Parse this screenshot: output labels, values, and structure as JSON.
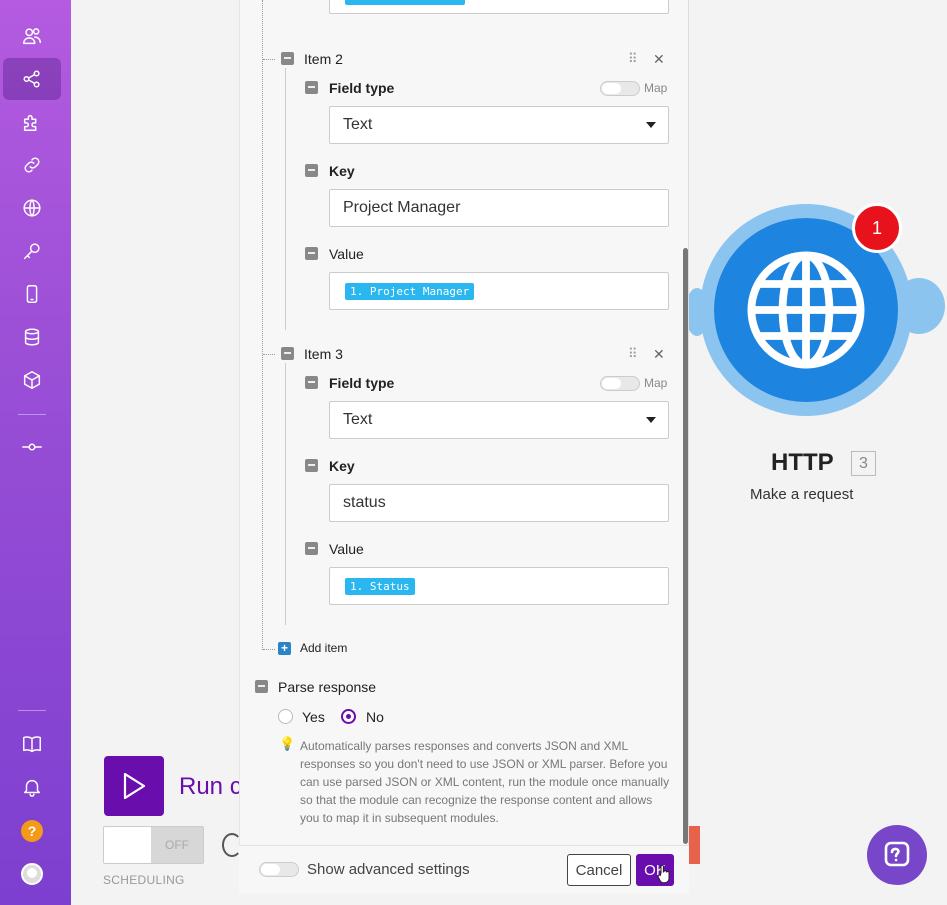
{
  "sidebar": {
    "items": [
      {
        "icon": "team-icon",
        "active": false
      },
      {
        "icon": "share-scenarios-icon",
        "active": true
      },
      {
        "icon": "puzzle-apps-icon",
        "active": false
      },
      {
        "icon": "link-connections-icon",
        "active": false
      },
      {
        "icon": "globe-webhooks-icon",
        "active": false
      },
      {
        "icon": "key-icon",
        "active": false
      },
      {
        "icon": "mobile-devices-icon",
        "active": false
      },
      {
        "icon": "database-datastores-icon",
        "active": false
      },
      {
        "icon": "cube-datastructures-icon",
        "active": false
      },
      {
        "icon": "flow-icon",
        "active": false
      }
    ],
    "bottom": [
      {
        "icon": "book-icon"
      },
      {
        "icon": "bell-icon"
      },
      {
        "icon": "help-icon",
        "text": "?"
      },
      {
        "icon": "avatar-icon"
      }
    ]
  },
  "panel": {
    "items": [
      {
        "label": "Item 2",
        "field_type_label": "Field type",
        "field_type_value": "Text",
        "map_label": "Map",
        "key_label": "Key",
        "key_value": "Project Manager",
        "value_label": "Value",
        "value_pill": "1. Project Manager"
      },
      {
        "label": "Item 3",
        "field_type_label": "Field type",
        "field_type_value": "Text",
        "map_label": "Map",
        "key_label": "Key",
        "key_value": "status",
        "value_label": "Value",
        "value_pill": "1. Status"
      }
    ],
    "add_item": "Add item",
    "parse_response": {
      "label": "Parse response",
      "yes": "Yes",
      "no": "No",
      "selected": "No",
      "help": "Automatically parses responses and converts JSON and XML responses so you don't need to use JSON or XML parser. Before you can use parsed JSON or XML content, run the module once manually so that the module can recognize the response content and allows you to map it in subsequent modules."
    },
    "footer": {
      "advanced_label": "Show advanced settings",
      "cancel": "Cancel",
      "ok": "OK"
    }
  },
  "canvas": {
    "run_label": "Run c",
    "toggle_label": "OFF",
    "scheduling_label": "SCHEDULING",
    "module": {
      "name": "HTTP",
      "id": "3",
      "subtitle": "Make a request",
      "badge": "1",
      "color": "#1d84e0"
    }
  },
  "colors": {
    "accent": "#6a0dad",
    "pill": "#2ab7f0",
    "badge": "#e8121d"
  }
}
